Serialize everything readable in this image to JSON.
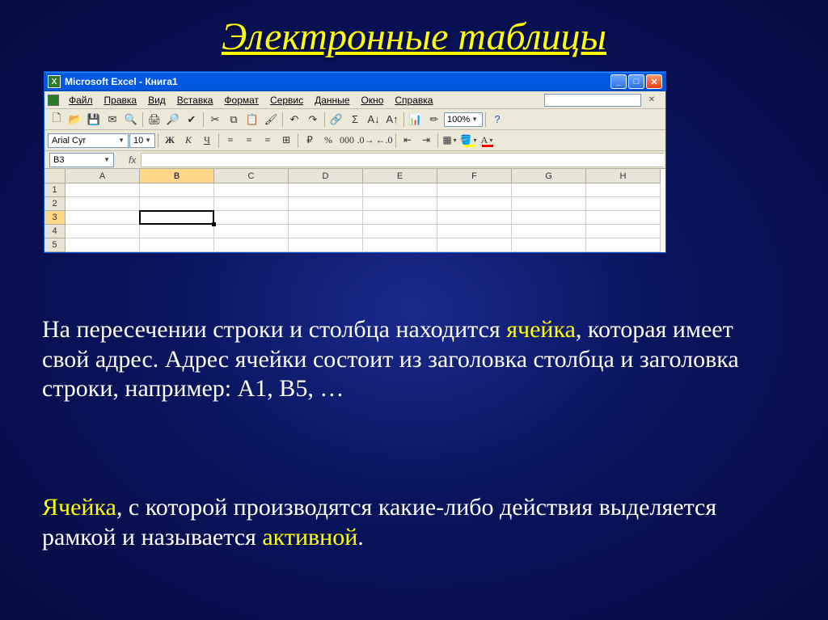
{
  "slide": {
    "title": "Электронные таблицы"
  },
  "window": {
    "title": "Microsoft Excel - Книга1",
    "menus": [
      "Файл",
      "Правка",
      "Вид",
      "Вставка",
      "Формат",
      "Сервис",
      "Данные",
      "Окно",
      "Справка"
    ],
    "zoom": "100%",
    "font_name": "Arial Cyr",
    "font_size": "10",
    "name_box": "B3",
    "fx_label": "fx",
    "columns": [
      "A",
      "B",
      "C",
      "D",
      "E",
      "F",
      "G",
      "H"
    ],
    "rows": [
      "1",
      "2",
      "3",
      "4",
      "5"
    ],
    "selected_col": "B",
    "selected_row": "3"
  },
  "para1": {
    "t1": "На пересечении строки и столбца находится ",
    "hl1": "ячейка",
    "t2": ", которая имеет свой адрес. Адрес ячейки состоит из заголовка столбца  и заголовка строки, например: A1, B5, …"
  },
  "para2": {
    "hl1": "Ячейка",
    "t1": ",  с которой производятся какие-либо действия выделяется рамкой и называется ",
    "hl2": "активной",
    "t2": "."
  }
}
